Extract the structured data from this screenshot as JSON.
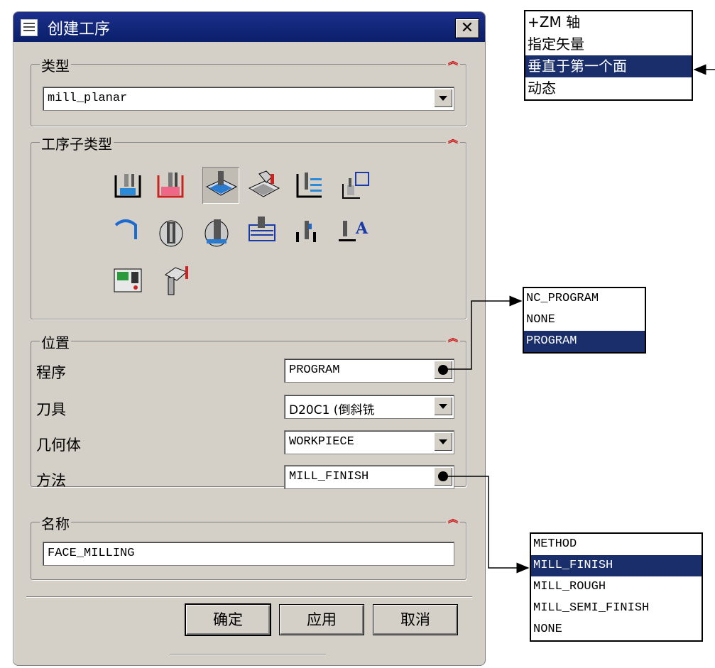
{
  "dialog": {
    "title": "创建工序",
    "close_glyph": "✕",
    "type_section": {
      "label": "类型",
      "value": "mill_planar"
    },
    "subtype_section": {
      "label": "工序子类型",
      "icons": [
        "floor-wall-icon",
        "floor-wall-ipw-icon",
        "face-milling-icon",
        "face-milling-manual-icon",
        "planar-mill-icon",
        "planar-profile-icon",
        "cleanup-corners-icon",
        "finish-walls-icon",
        "finish-floor-icon",
        "hole-milling-icon",
        "groove-milling-icon",
        "planar-text-icon",
        "mill-control-icon",
        "mill-user-icon"
      ]
    },
    "location_section": {
      "label": "位置",
      "rows": [
        {
          "label": "程序",
          "value": "PROGRAM"
        },
        {
          "label": "刀具",
          "value": "D20C1 (倒斜铣"
        },
        {
          "label": "几何体",
          "value": "WORKPIECE"
        },
        {
          "label": "方法",
          "value": "MILL_FINISH"
        }
      ]
    },
    "name_section": {
      "label": "名称",
      "value": "FACE_MILLING"
    },
    "buttons": {
      "ok": "确定",
      "apply": "应用",
      "cancel": "取消"
    }
  },
  "popups": {
    "vector": {
      "items": [
        "+ZM 轴",
        "指定矢量",
        "垂直于第一个面",
        "动态"
      ],
      "selected_index": 2
    },
    "program": {
      "items": [
        "NC_PROGRAM",
        "NONE",
        "PROGRAM"
      ],
      "selected_index": 2
    },
    "method": {
      "items": [
        "METHOD",
        "MILL_FINISH",
        "MILL_ROUGH",
        "MILL_SEMI_FINISH",
        "NONE"
      ],
      "selected_index": 1
    }
  },
  "colors": {
    "title_bar": "#0a1f6a",
    "dialog_bg": "#d4d0c8",
    "selection": "#1a2e6c",
    "collapse_chevron": "#cc1111"
  }
}
